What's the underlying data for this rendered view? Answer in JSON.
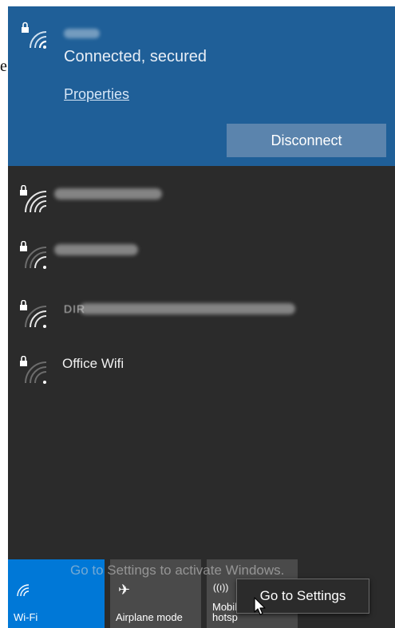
{
  "background_text": "e",
  "connected_network": {
    "status": "Connected, secured",
    "properties_label": "Properties",
    "disconnect_label": "Disconnect"
  },
  "networks": [
    {
      "name": "",
      "secured": true
    },
    {
      "name": "",
      "secured": true
    },
    {
      "name": "DIR",
      "secured": true
    },
    {
      "name": "Office Wifi",
      "secured": true
    }
  ],
  "quick_actions": {
    "wifi_label": "Wi-Fi",
    "airplane_label": "Airplane mode",
    "hotspot_label_line1": "Mobil",
    "hotspot_label_line2": "hotsp"
  },
  "watermark": "Go to Settings to activate Windows.",
  "context_menu": {
    "go_to_settings": "Go to Settings"
  },
  "colors": {
    "panel_bg": "#2b2b2b",
    "connected_bg": "#1f5f98",
    "accent": "#0078d7",
    "tile_inactive": "#4a4a4a"
  }
}
